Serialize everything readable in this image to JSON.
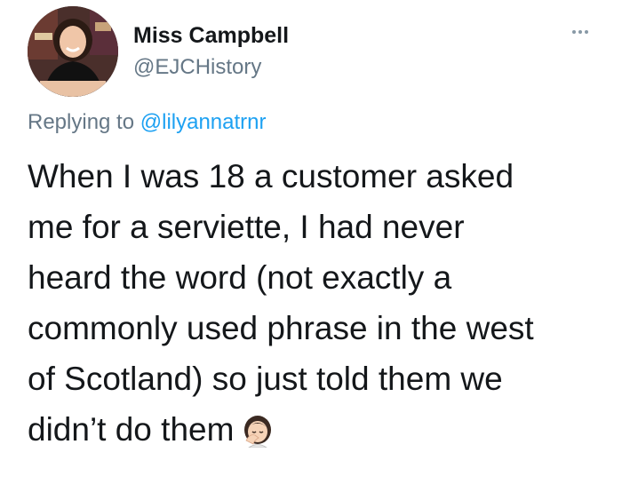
{
  "tweet": {
    "author": {
      "name": "Miss Campbell",
      "handle": "@EJCHistory",
      "avatar": "profile-photo"
    },
    "more_icon": "more-options-icon",
    "reply": {
      "prefix": "Replying to",
      "mention": "@lilyannatrnr"
    },
    "text_lines": [
      "When I was 18 a customer asked",
      "me for a serviette, I had never",
      "heard the word (not exactly a",
      "commonly used phrase in the west",
      "of Scotland) so just told them we",
      "didn’t do them"
    ],
    "emoji": "woman-facepalming-emoji",
    "colors": {
      "text": "#14171a",
      "secondary": "#657786",
      "link": "#1da1f2"
    }
  }
}
